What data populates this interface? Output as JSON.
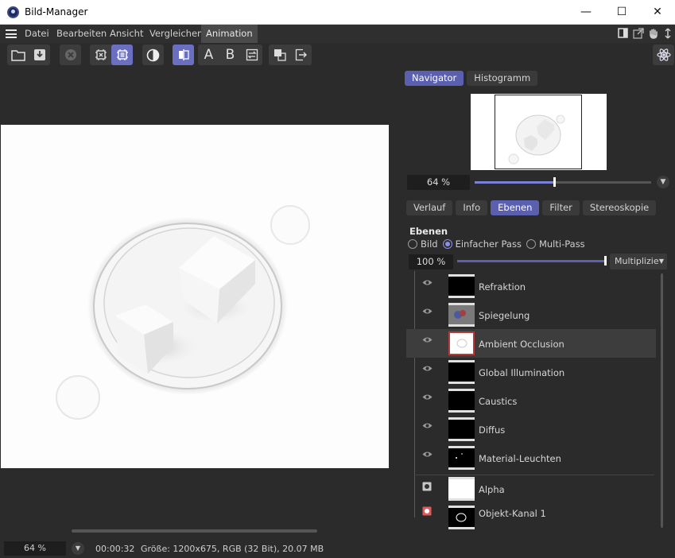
{
  "window": {
    "title": "Bild-Manager",
    "minimize": "—",
    "maximize": "☐",
    "close": "✕"
  },
  "menu": {
    "items": [
      "Datei",
      "Bearbeiten",
      "Ansicht",
      "Vergleichen",
      "Animation"
    ],
    "active": "Animation"
  },
  "toolbar": {
    "icons": [
      "folder-open-icon",
      "save-icon",
      "stop-icon",
      "render-region-icon",
      "render-view-icon",
      "contrast-icon",
      "compare-ab-icon",
      "slot-a-icon",
      "slot-b-icon",
      "swap-icon",
      "overlay-icon",
      "export-icon",
      "settings-icon"
    ],
    "label_a": "A",
    "label_b": "B"
  },
  "navigator": {
    "tabs": [
      "Navigator",
      "Histogramm"
    ],
    "active_tab": "Navigator",
    "zoom": "64 %",
    "zoom_fraction": 0.45
  },
  "info_tabs": {
    "tabs": [
      "Verlauf",
      "Info",
      "Ebenen",
      "Filter",
      "Stereoskopie"
    ],
    "active_tab": "Ebenen"
  },
  "layers_panel": {
    "title": "Ebenen",
    "modes": [
      "Bild",
      "Einfacher Pass",
      "Multi-Pass"
    ],
    "selected_mode": "Einfacher Pass",
    "opacity": "100 %",
    "opacity_fraction": 1.0,
    "blend_mode": "Multiplizie",
    "layers": [
      {
        "name": "Refraktion",
        "visible": true
      },
      {
        "name": "Spiegelung",
        "visible": true
      },
      {
        "name": "Ambient Occlusion",
        "visible": true,
        "selected": true
      },
      {
        "name": "Global Illumination",
        "visible": true
      },
      {
        "name": "Caustics",
        "visible": true
      },
      {
        "name": "Diffus",
        "visible": true
      },
      {
        "name": "Material-Leuchten",
        "visible": true
      }
    ],
    "extra_layers": [
      {
        "name": "Alpha",
        "mark_color": "#c8c8c8"
      },
      {
        "name": "Objekt-Kanal 1",
        "mark_color": "#e05a5a"
      }
    ]
  },
  "status": {
    "zoom": "64 %",
    "time": "00:00:32",
    "info": "Größe: 1200x675, RGB (32 Bit), 20.07 MB"
  },
  "colors": {
    "accent": "#5a5fb0",
    "background": "#2b2b2b",
    "selection_border": "#b63a3a"
  }
}
